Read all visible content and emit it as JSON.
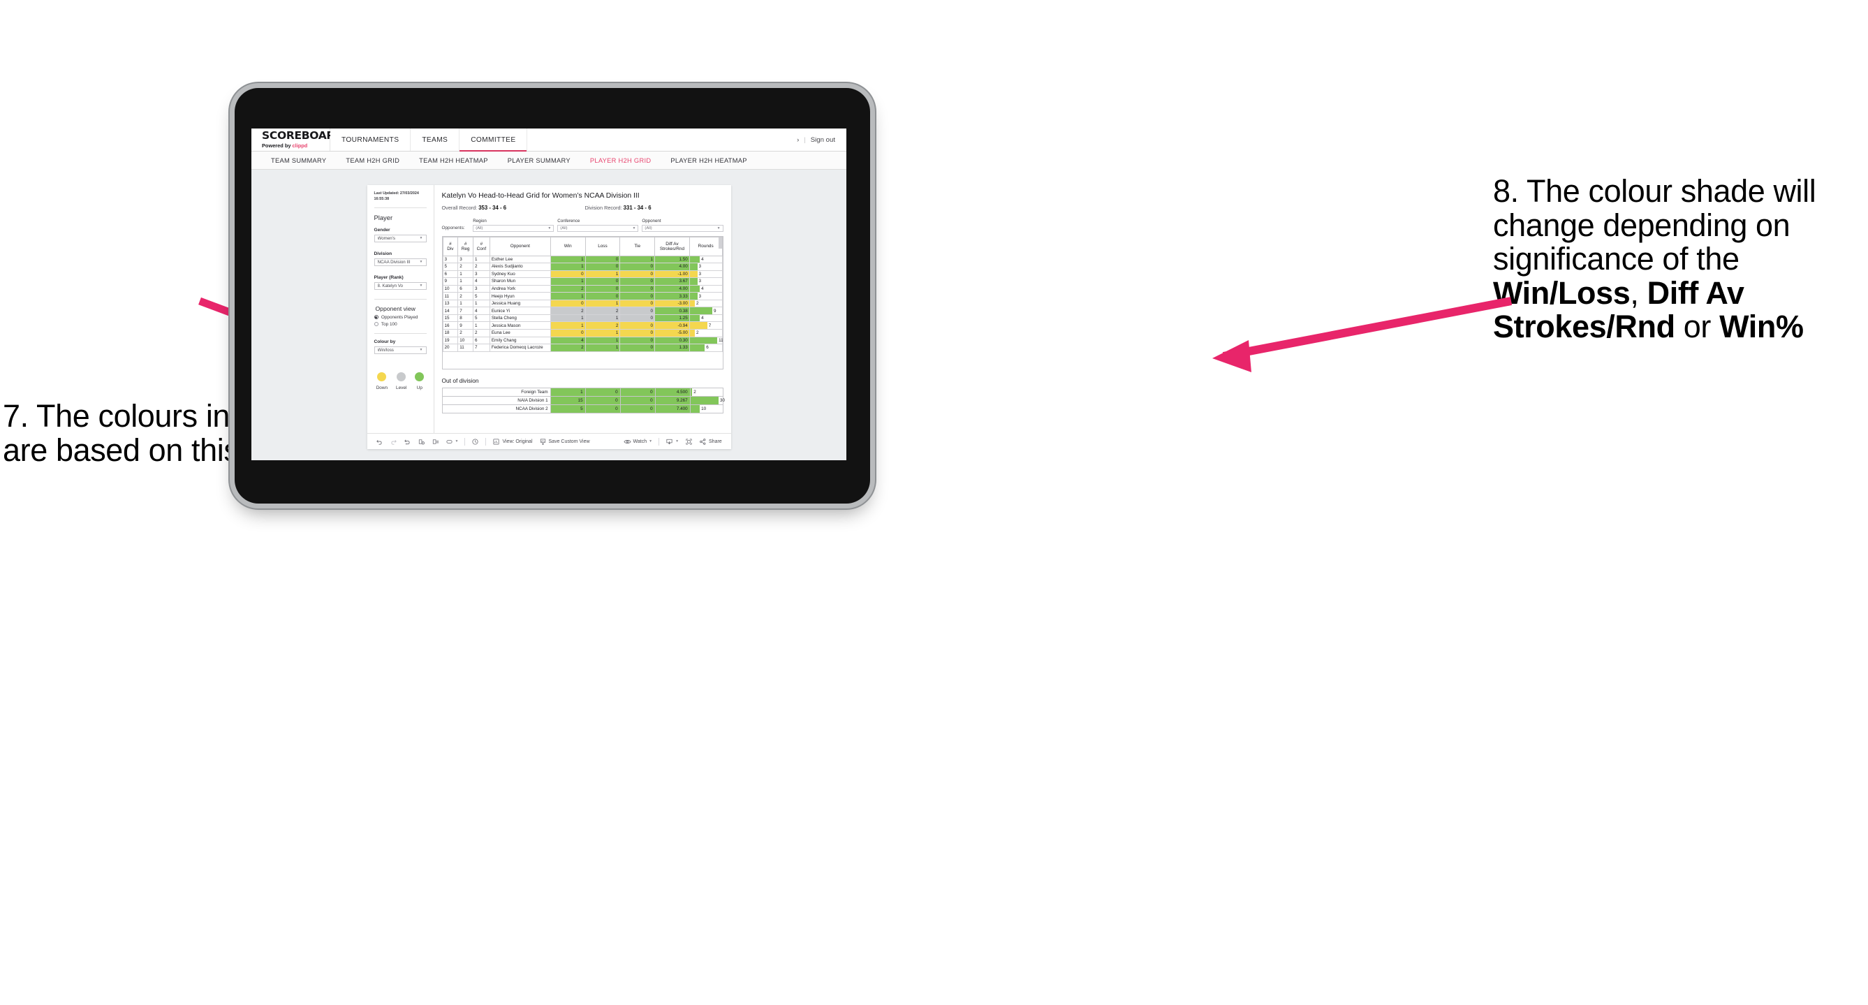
{
  "annotations": {
    "left": {
      "num": "7.",
      "text": "The colours in the grid are based on this selection"
    },
    "right": {
      "p1": "8. The colour shade will change depending on significance of the ",
      "b1": "Win/Loss",
      "mid1": ", ",
      "b2": "Diff Av Strokes/Rnd",
      "mid2": " or ",
      "b3": "Win%"
    },
    "arrow_color": "#e8256a"
  },
  "app": {
    "brand": {
      "title": "SCOREBOARD",
      "powered_prefix": "Powered by ",
      "powered_brand": "clippd"
    },
    "nav_tabs": [
      {
        "label": "TOURNAMENTS",
        "active": false
      },
      {
        "label": "TEAMS",
        "active": false
      },
      {
        "label": "COMMITTEE",
        "active": true
      }
    ],
    "account": {
      "chevron": "›",
      "divider": "|",
      "sign_out": "Sign out"
    },
    "sub_tabs": [
      {
        "label": "TEAM SUMMARY",
        "active": false
      },
      {
        "label": "TEAM H2H GRID",
        "active": false
      },
      {
        "label": "TEAM H2H HEATMAP",
        "active": false
      },
      {
        "label": "PLAYER SUMMARY",
        "active": false
      },
      {
        "label": "PLAYER H2H GRID",
        "active": true
      },
      {
        "label": "PLAYER H2H HEATMAP",
        "active": false
      }
    ],
    "accent_pink": "#e8456f"
  },
  "panel": {
    "last_updated": "Last Updated: 27/03/2024 16:55:38",
    "heading": "Player",
    "fields": [
      {
        "label": "Gender",
        "value": "Women's"
      },
      {
        "label": "Division",
        "value": "NCAA Division III"
      },
      {
        "label": "Player (Rank)",
        "value": "8. Katelyn Vo"
      }
    ],
    "opponent_view": {
      "heading": "Opponent view",
      "options": [
        {
          "label": "Opponents Played",
          "selected": true
        },
        {
          "label": "Top 100",
          "selected": false
        }
      ]
    },
    "colour_by": {
      "label": "Colour by",
      "value": "Win/loss"
    },
    "legend": [
      {
        "label": "Down",
        "color": "#f3d64e"
      },
      {
        "label": "Level",
        "color": "#c7c9cb"
      },
      {
        "label": "Up",
        "color": "#7ec champion"
      }
    ]
  },
  "legend_colors": {
    "down": "#f4d74f",
    "level": "#c8cacc",
    "up": "#82c65a"
  },
  "main": {
    "title": "Katelyn Vo Head-to-Head Grid for Women’s NCAA Division III",
    "overall_record_label": "Overall Record: ",
    "overall_record_value": "353 -  34 - 6",
    "division_record_label": "Division Record: ",
    "division_record_value": "331 -  34 - 6",
    "opponents_label": "Opponents:",
    "opponent_filters": [
      {
        "label": "Region",
        "value": "(All)"
      },
      {
        "label": "Conference",
        "value": "(All)"
      },
      {
        "label": "Opponent",
        "value": "(All)"
      }
    ],
    "out_of_division_title": "Out of division"
  },
  "chart_data": {
    "type": "table",
    "title": "Katelyn Vo Head-to-Head Grid for Women’s NCAA Division III",
    "columns": [
      "# Div",
      "# Reg",
      "# Conf",
      "Opponent",
      "Win",
      "Loss",
      "Tie",
      "Diff Av Strokes/Rnd",
      "Rounds"
    ],
    "column_headers_two_line": [
      {
        "l1": "#",
        "l2": "Div"
      },
      {
        "l1": "#",
        "l2": "Reg"
      },
      {
        "l1": "#",
        "l2": "Conf"
      },
      {
        "l1": "Opponent",
        "l2": ""
      },
      {
        "l1": "Win",
        "l2": ""
      },
      {
        "l1": "Loss",
        "l2": ""
      },
      {
        "l1": "Tie",
        "l2": ""
      },
      {
        "l1": "Diff Av",
        "l2": "Strokes/Rnd"
      },
      {
        "l1": "Rounds",
        "l2": ""
      }
    ],
    "rounds_max": 11,
    "rows": [
      {
        "div": "3",
        "reg": "3",
        "conf": "1",
        "opponent": "Esther Lee",
        "win": "1",
        "loss": "0",
        "tie": "1",
        "diff": "1.50",
        "rounds": "4",
        "rounds_val": 4,
        "color": "up"
      },
      {
        "div": "5",
        "reg": "2",
        "conf": "2",
        "opponent": "Alexis Sudjianto",
        "win": "1",
        "loss": "0",
        "tie": "0",
        "diff": "4.00",
        "rounds": "3",
        "rounds_val": 3,
        "color": "up"
      },
      {
        "div": "6",
        "reg": "1",
        "conf": "3",
        "opponent": "Sydney Kuo",
        "win": "0",
        "loss": "1",
        "tie": "0",
        "diff": "-1.00",
        "rounds": "3",
        "rounds_val": 3,
        "color": "down"
      },
      {
        "div": "9",
        "reg": "1",
        "conf": "4",
        "opponent": "Sharon Mun",
        "win": "1",
        "loss": "0",
        "tie": "0",
        "diff": "3.67",
        "rounds": "3",
        "rounds_val": 3,
        "color": "up"
      },
      {
        "div": "10",
        "reg": "6",
        "conf": "3",
        "opponent": "Andrea York",
        "win": "2",
        "loss": "0",
        "tie": "0",
        "diff": "4.00",
        "rounds": "4",
        "rounds_val": 4,
        "color": "up"
      },
      {
        "div": "11",
        "reg": "2",
        "conf": "5",
        "opponent": "Heejo Hyun",
        "win": "1",
        "loss": "0",
        "tie": "0",
        "diff": "3.33",
        "rounds": "3",
        "rounds_val": 3,
        "color": "up"
      },
      {
        "div": "13",
        "reg": "1",
        "conf": "1",
        "opponent": "Jessica Huang",
        "win": "0",
        "loss": "1",
        "tie": "0",
        "diff": "-3.00",
        "rounds": "2",
        "rounds_val": 2,
        "color": "down"
      },
      {
        "div": "14",
        "reg": "7",
        "conf": "4",
        "opponent": "Eunice Yi",
        "win": "2",
        "loss": "2",
        "tie": "0",
        "diff": "0.38",
        "rounds": "9",
        "rounds_val": 9,
        "color": "level",
        "diff_color": "up"
      },
      {
        "div": "15",
        "reg": "8",
        "conf": "5",
        "opponent": "Stella Cheng",
        "win": "1",
        "loss": "1",
        "tie": "0",
        "diff": "1.25",
        "rounds": "4",
        "rounds_val": 4,
        "color": "level",
        "diff_color": "up"
      },
      {
        "div": "16",
        "reg": "9",
        "conf": "1",
        "opponent": "Jessica Mason",
        "win": "1",
        "loss": "2",
        "tie": "0",
        "diff": "-0.94",
        "rounds": "7",
        "rounds_val": 7,
        "color": "down"
      },
      {
        "div": "18",
        "reg": "2",
        "conf": "2",
        "opponent": "Euna Lee",
        "win": "0",
        "loss": "1",
        "tie": "0",
        "diff": "-5.00",
        "rounds": "2",
        "rounds_val": 2,
        "color": "down"
      },
      {
        "div": "19",
        "reg": "10",
        "conf": "6",
        "opponent": "Emily Chang",
        "win": "4",
        "loss": "1",
        "tie": "0",
        "diff": "0.30",
        "rounds": "11",
        "rounds_val": 11,
        "color": "up"
      },
      {
        "div": "20",
        "reg": "11",
        "conf": "7",
        "opponent": "Federica Domecq Lacroze",
        "win": "2",
        "loss": "1",
        "tie": "0",
        "diff": "1.33",
        "rounds": "6",
        "rounds_val": 6,
        "color": "up"
      }
    ],
    "out_of_division": {
      "rounds_max": 30,
      "rows": [
        {
          "name": "Foreign Team",
          "win": "1",
          "loss": "0",
          "tie": "0",
          "diff": "4.500",
          "rounds": "2",
          "rounds_val": 2,
          "color": "up"
        },
        {
          "name": "NAIA Division 1",
          "win": "15",
          "loss": "0",
          "tie": "0",
          "diff": "9.267",
          "rounds": "30",
          "rounds_val": 30,
          "color": "up"
        },
        {
          "name": "NCAA Division 2",
          "win": "5",
          "loss": "0",
          "tie": "0",
          "diff": "7.400",
          "rounds": "10",
          "rounds_val": 10,
          "color": "up"
        }
      ]
    }
  },
  "toolbar": {
    "view_label": "View: Original",
    "save_label": "Save Custom View",
    "watch_label": "Watch",
    "share_label": "Share"
  }
}
